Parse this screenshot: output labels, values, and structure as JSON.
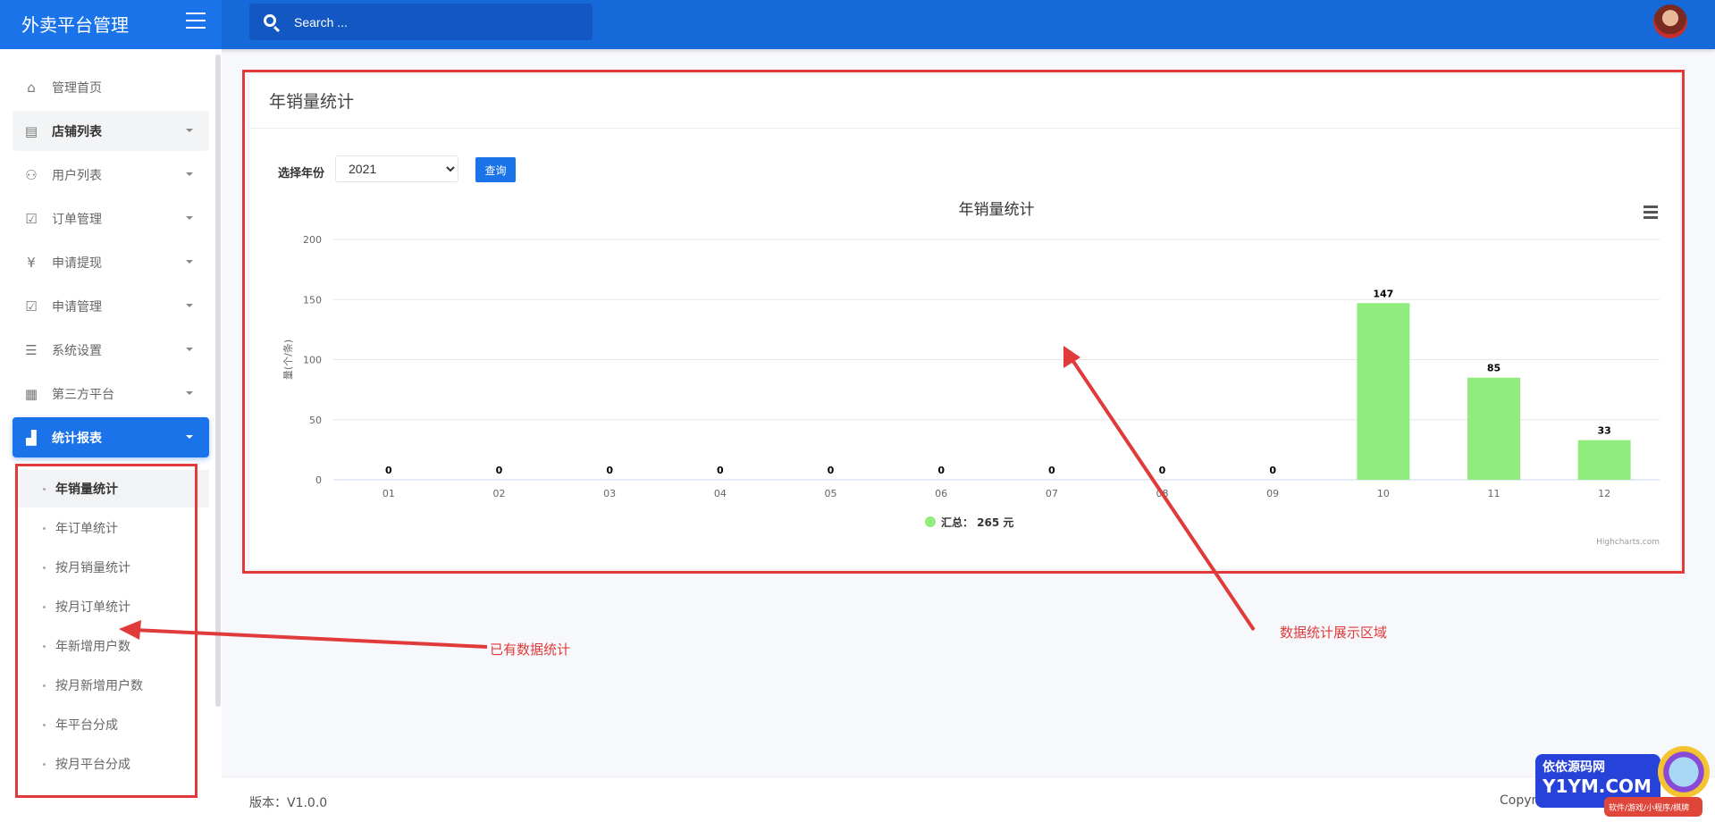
{
  "header": {
    "brand": "外卖平台管理",
    "search_placeholder": "Search ..."
  },
  "sidebar": {
    "items": [
      {
        "label": "管理首页",
        "icon": "home-icon"
      },
      {
        "label": "店铺列表",
        "icon": "store-icon"
      },
      {
        "label": "用户列表",
        "icon": "users-icon"
      },
      {
        "label": "订单管理",
        "icon": "clipboard-check-icon"
      },
      {
        "label": "申请提现",
        "icon": "yen-icon"
      },
      {
        "label": "申请管理",
        "icon": "clipboard-check-icon"
      },
      {
        "label": "系统设置",
        "icon": "sliders-icon"
      },
      {
        "label": "第三方平台",
        "icon": "grid-icon"
      },
      {
        "label": "统计报表",
        "icon": "bar-chart-icon"
      }
    ],
    "subitems": [
      "年销量统计",
      "年订单统计",
      "按月销量统计",
      "按月订单统计",
      "年新增用户数",
      "按月新增用户数",
      "年平台分成",
      "按月平台分成"
    ]
  },
  "card": {
    "title": "年销量统计",
    "year_label": "选择年份",
    "year_value": "2021",
    "query_label": "查询"
  },
  "chart_data": {
    "type": "bar",
    "title": "年销量统计",
    "ylabel": "量(个/条)",
    "categories": [
      "01",
      "02",
      "03",
      "04",
      "05",
      "06",
      "07",
      "08",
      "09",
      "10",
      "11",
      "12"
    ],
    "series": [
      {
        "name": "汇总： 265 元",
        "values": [
          0,
          0,
          0,
          0,
          0,
          0,
          0,
          0,
          0,
          147,
          85,
          33
        ],
        "color": "#90ed7d"
      }
    ],
    "ylim": [
      0,
      200
    ],
    "yticks": [
      0,
      50,
      100,
      150,
      200
    ],
    "grid": true,
    "legend": "bottom-center",
    "credits": "Highcharts.com"
  },
  "annotations": {
    "sidebar_note": "已有数据统计",
    "main_note": "数据统计展示区域",
    "color": "#e03a3a"
  },
  "footer": {
    "version": "版本：V1.0.0",
    "copyright": "Copyr"
  },
  "watermark": {
    "line1": "依依源码网",
    "line2": "Y1YM.COM",
    "line3": "软件/游戏/小程序/棋牌"
  }
}
